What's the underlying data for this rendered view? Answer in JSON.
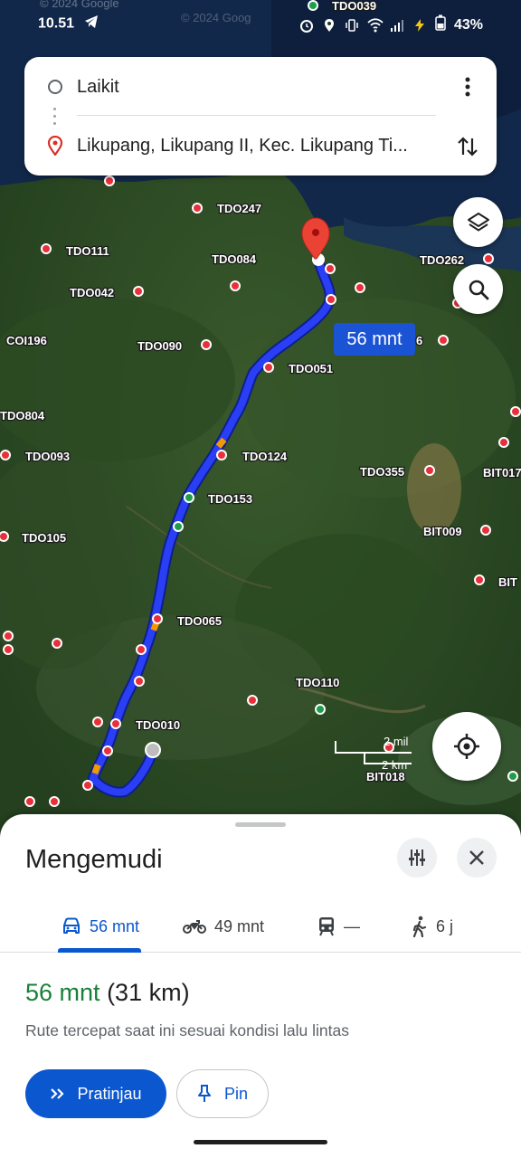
{
  "status_bar": {
    "time": "10.51",
    "battery": "43%",
    "icons": [
      "telegram-icon",
      "alarm-icon",
      "location-icon",
      "vibrate-icon",
      "wifi-icon",
      "signal-icon",
      "charging-icon",
      "battery-icon"
    ]
  },
  "route_card": {
    "origin": "Laikit",
    "destination": "Likupang, Likupang II, Kec. Likupang Ti...",
    "icons": [
      "origin-circle-icon",
      "destination-pin-icon",
      "more-vert-icon",
      "swap-icon"
    ]
  },
  "map": {
    "route_time_bubble": "56 mnt",
    "scale_top": "2 mil",
    "scale_bottom": "2 km",
    "labels": [
      {
        "text": "TDO039"
      },
      {
        "text": "TDO247"
      },
      {
        "text": "TDO111"
      },
      {
        "text": "TDO084"
      },
      {
        "text": "TDO262"
      },
      {
        "text": "TDO042"
      },
      {
        "text": "COI196"
      },
      {
        "text": "TDO090"
      },
      {
        "text": "TDO051"
      },
      {
        "text": "6"
      },
      {
        "text": "TDO804"
      },
      {
        "text": "TDO093"
      },
      {
        "text": "TDO124"
      },
      {
        "text": "TDO355"
      },
      {
        "text": "BIT017"
      },
      {
        "text": "TDO153"
      },
      {
        "text": "TDO105"
      },
      {
        "text": "BIT009"
      },
      {
        "text": "BIT"
      },
      {
        "text": "TDO065"
      },
      {
        "text": "TDO110"
      },
      {
        "text": "TDO010"
      },
      {
        "text": "BIT018"
      }
    ],
    "watermark_1": "© 2024 Google",
    "watermark_2": "© 2024 Goog"
  },
  "sheet": {
    "title": "Mengemudi",
    "modes": [
      {
        "icon": "car-icon",
        "label": "56 mnt",
        "active": true
      },
      {
        "icon": "motorcycle-icon",
        "label": "49 mnt",
        "active": false
      },
      {
        "icon": "train-icon",
        "label": "—",
        "active": false
      },
      {
        "icon": "walk-icon",
        "label": "6 j",
        "active": false
      }
    ],
    "route_time": "56 mnt",
    "route_distance": "(31 km)",
    "route_description": "Rute tercepat saat ini sesuai kondisi lalu lintas",
    "preview_label": "Pratinjau",
    "pin_label": "Pin"
  },
  "colors": {
    "route": "#2a3ff5",
    "accent": "#0b57d0",
    "time_green": "#188038",
    "marker_red": "#e8303a",
    "marker_green": "#1e9e4a"
  }
}
